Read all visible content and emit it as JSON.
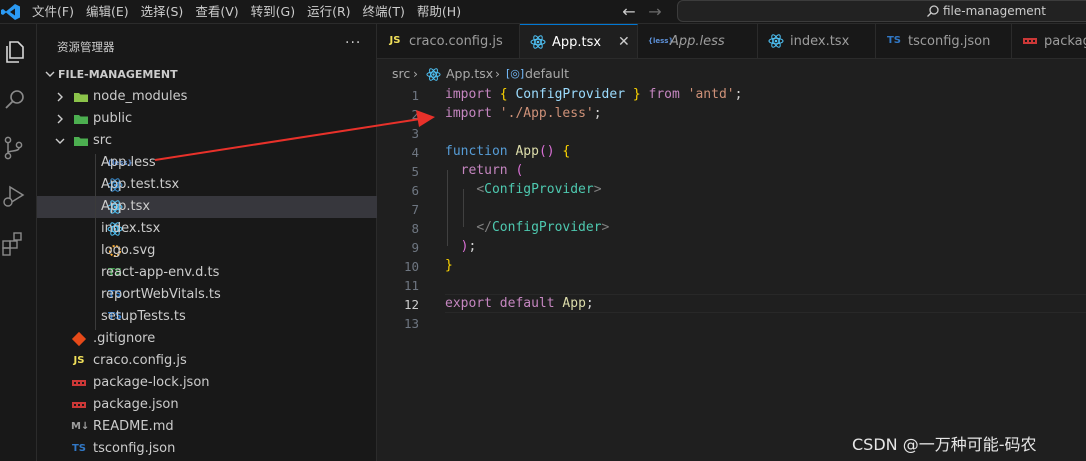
{
  "menu": [
    "文件(F)",
    "编辑(E)",
    "选择(S)",
    "查看(V)",
    "转到(G)",
    "运行(R)",
    "终端(T)",
    "帮助(H)"
  ],
  "search": {
    "text": "file-management"
  },
  "sidebar": {
    "title": "资源管理器",
    "more": "···",
    "root": "FILE-MANAGEMENT",
    "items": [
      {
        "name": "node_modules",
        "icon": "folder-node-icon",
        "icon_text": "",
        "color": "#8bc34a"
      },
      {
        "name": "public",
        "icon": "folder-public-icon",
        "icon_text": "",
        "color": "#4caf50"
      },
      {
        "name": "src",
        "icon": "folder-src-icon",
        "icon_text": "",
        "color": "#4caf50"
      },
      {
        "name": "App.less",
        "icon": "less-file-icon",
        "icon_text": "{less}",
        "color": "#5c8fd6"
      },
      {
        "name": "App.test.tsx",
        "icon": "test-file-icon",
        "icon_text": "",
        "color": "#3d8fd1"
      },
      {
        "name": "App.tsx",
        "icon": "react-file-icon",
        "icon_text": "",
        "color": "#4fc3f7"
      },
      {
        "name": "index.tsx",
        "icon": "react-file-icon",
        "icon_text": "",
        "color": "#4fc3f7"
      },
      {
        "name": "logo.svg",
        "icon": "svg-file-icon",
        "icon_text": "",
        "color": "#ffb13b"
      },
      {
        "name": "react-app-env.d.ts",
        "icon": "ts-file-icon",
        "icon_text": "TS",
        "color": "#3fa34d"
      },
      {
        "name": "reportWebVitals.ts",
        "icon": "ts-file-icon",
        "icon_text": "TS",
        "color": "#3178c6"
      },
      {
        "name": "setupTests.ts",
        "icon": "ts-file-icon",
        "icon_text": "TS",
        "color": "#3178c6"
      },
      {
        "name": ".gitignore",
        "icon": "git-file-icon",
        "icon_text": "",
        "color": "#e64a19"
      },
      {
        "name": "craco.config.js",
        "icon": "js-file-icon",
        "icon_text": "JS",
        "color": "#f1e05a"
      },
      {
        "name": "package-lock.json",
        "icon": "npm-file-icon",
        "icon_text": "",
        "color": "#cb3837"
      },
      {
        "name": "package.json",
        "icon": "npm-file-icon",
        "icon_text": "",
        "color": "#cb3837"
      },
      {
        "name": "README.md",
        "icon": "markdown-file-icon",
        "icon_text": "M↓",
        "color": "#9e9e9e"
      },
      {
        "name": "tsconfig.json",
        "icon": "tsconfig-file-icon",
        "icon_text": "TS",
        "color": "#3178c6"
      }
    ]
  },
  "tabs": [
    {
      "label": "craco.config.js",
      "icon_text": "JS",
      "color": "#f1e05a",
      "active": false
    },
    {
      "label": "App.tsx",
      "icon_text": "",
      "color": "#4fc3f7",
      "active": true,
      "close": "✕"
    },
    {
      "label": "App.less",
      "icon_text": "{less}",
      "color": "#5c8fd6",
      "active": false
    },
    {
      "label": "index.tsx",
      "icon_text": "",
      "color": "#4fc3f7",
      "active": false
    },
    {
      "label": "tsconfig.json",
      "icon_text": "TS",
      "color": "#3178c6",
      "active": false
    },
    {
      "label": "package.json",
      "icon_text": "",
      "color": "#cb3837",
      "active": false
    }
  ],
  "breadcrumb": {
    "folder": "src",
    "file": "App.tsx",
    "symbol": "default"
  },
  "editor": {
    "current_line": 12,
    "line_numbers": [
      "1",
      "2",
      "3",
      "4",
      "5",
      "6",
      "7",
      "8",
      "9",
      "10",
      "11",
      "12",
      "13"
    ],
    "code": {
      "l1_import": "import",
      "l1_open": "{",
      "l1_id": "ConfigProvider",
      "l1_close": "}",
      "l1_from": "from",
      "l1_str": "'antd'",
      "l1_semi": ";",
      "l2_import": "import",
      "l2_str": "'./App.less'",
      "l2_semi": ";",
      "l4_function": "function",
      "l4_name": "App",
      "l4_parens": "()",
      "l4_brace": "{",
      "l5_return": "return",
      "l5_paren": "(",
      "l6_lt": "<",
      "l6_tag": "ConfigProvider",
      "l6_gt": ">",
      "l8_lt": "</",
      "l8_tag": "ConfigProvider",
      "l8_gt": ">",
      "l9_paren": ")",
      "l9_semi": ";",
      "l10_brace": "}",
      "l12_export": "export",
      "l12_default": "default",
      "l12_name": "App",
      "l12_semi": ";"
    }
  },
  "watermark": "CSDN @一万种可能-码农",
  "colors": {
    "accent": "#0078d4",
    "arrow": "#e8312a"
  }
}
